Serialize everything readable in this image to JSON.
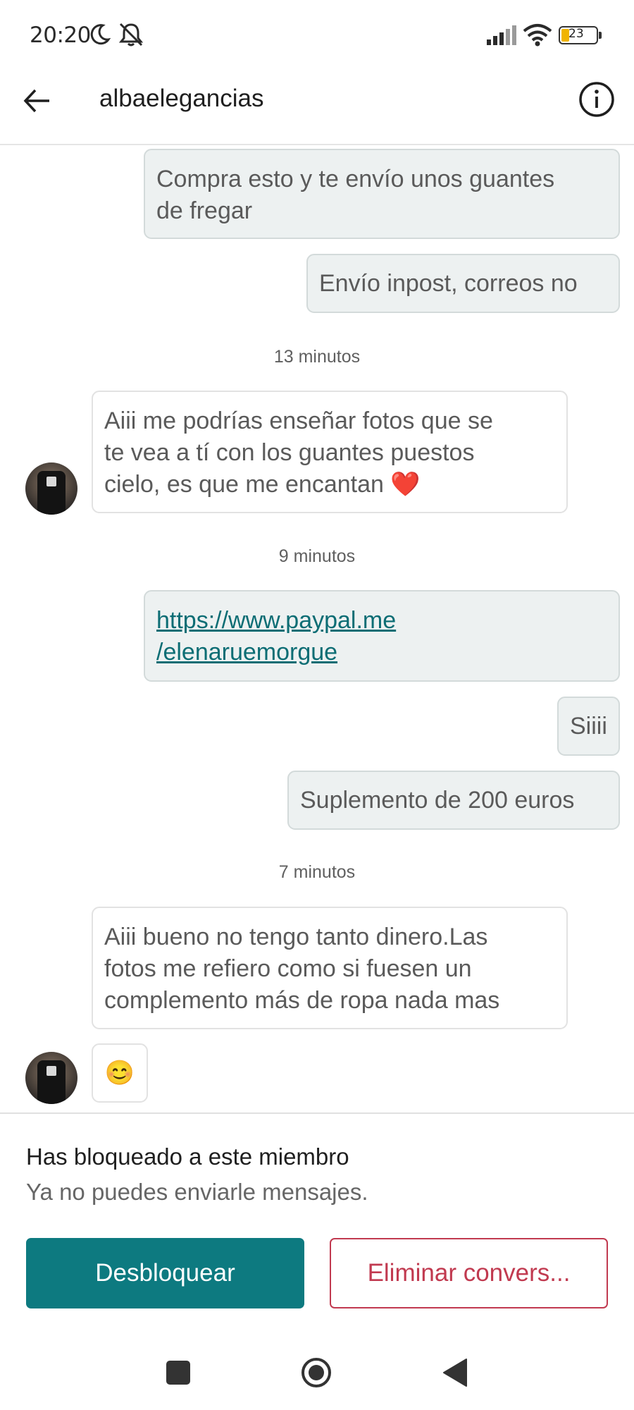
{
  "status_bar": {
    "time": "20:20",
    "battery": "23",
    "icons": [
      "moon-icon",
      "bell-off-icon",
      "signal-icon",
      "wifi-icon",
      "battery-icon"
    ]
  },
  "header": {
    "title": "albaelegancias",
    "back_icon": "arrow-left-icon",
    "info_icon": "info-icon"
  },
  "messages": [
    {
      "from": "me",
      "text": "Compra esto y te envío unos guantes de fregar"
    },
    {
      "from": "me",
      "text": "Envío inpost, correos no"
    },
    {
      "separator": "13 minutos"
    },
    {
      "from": "them",
      "text": "Aiii me podrías enseñar fotos que se te vea a tí con los guantes puestos cielo, es que me encantan ❤️"
    },
    {
      "separator": "9 minutos"
    },
    {
      "from": "me",
      "text": "https://www.paypal.me/elenaruemorgue",
      "link": true
    },
    {
      "from": "me",
      "text": "Siiii"
    },
    {
      "from": "me",
      "text": "Suplemento de 200 euros"
    },
    {
      "separator": "7 minutos"
    },
    {
      "from": "them",
      "text": "Aiii bueno no tengo tanto dinero.Las fotos me refiero como si fuesen un complemento más de ropa nada mas"
    },
    {
      "from": "them",
      "text": "😊"
    }
  ],
  "chat": {
    "m1_line1": "Compra esto y te envío unos guantes",
    "m1_line2": "de fregar",
    "m2": "Envío inpost, correos no",
    "sep1": "13 minutos",
    "m3_line1": "Aiii me podrías enseñar fotos que se",
    "m3_line2": "te vea a tí con los guantes puestos",
    "m3_line3": "cielo, es que me encantan ❤️",
    "sep2": "9 minutos",
    "m4_line1": "https://www.paypal.me",
    "m4_line2": "/elenaruemorgue",
    "m5": "Siiii",
    "m6": "Suplemento de 200 euros",
    "sep3": "7 minutos",
    "m7_line1": "Aiii bueno no tengo tanto dinero.Las",
    "m7_line2": "fotos me refiero como si fuesen un",
    "m7_line3": "complemento más de ropa nada mas",
    "m8": "😊"
  },
  "blocked_panel": {
    "title": "Has bloqueado a este miembro",
    "subtitle": "Ya no puedes enviarle mensajes.",
    "unblock_label": "Desbloquear",
    "delete_label": "Eliminar convers..."
  },
  "nav_bar": {
    "icons": [
      "recents-square-icon",
      "home-circle-icon",
      "back-triangle-icon"
    ]
  },
  "colors": {
    "accent": "#0d7a80",
    "danger": "#c13a50",
    "outgoing_bubble": "#edf1f1",
    "link": "#0c6d74"
  }
}
